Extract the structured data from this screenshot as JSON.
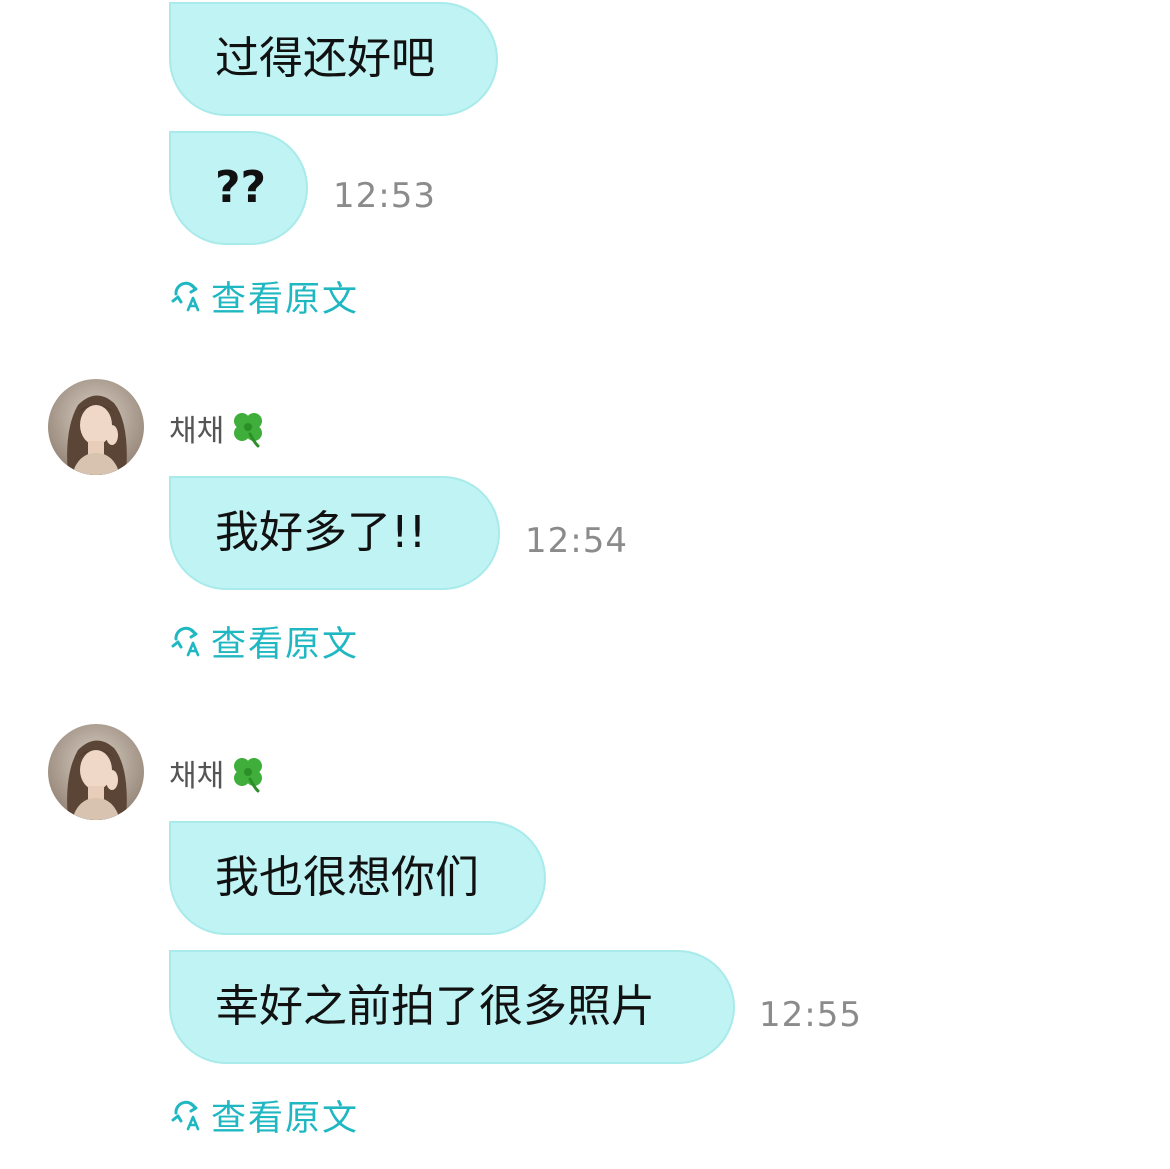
{
  "messages": {
    "m1": "过得还好吧",
    "m2": "??",
    "m2_time": "12:53",
    "m3": "我好多了!!",
    "m3_time": "12:54",
    "m4": "我也很想你们",
    "m5": "幸好之前拍了很多照片",
    "m5_time": "12:55"
  },
  "translate_label": "查看原文",
  "sender_name": "채채",
  "icons": {
    "translate": "translate-icon",
    "clover": "four-leaf-clover-icon",
    "avatar": "profile-avatar"
  },
  "colors": {
    "bubble": "#bff3f4",
    "accent": "#1fb7c1",
    "time": "#8b8b8b"
  }
}
